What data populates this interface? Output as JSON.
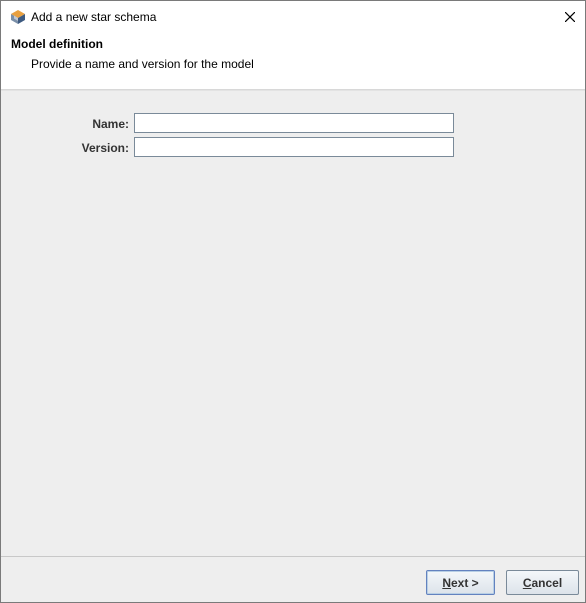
{
  "window": {
    "title": "Add a new star schema",
    "app_icon": "pentaho-cube-icon",
    "close_icon": "close-icon"
  },
  "header": {
    "title": "Model definition",
    "description": "Provide a name and version for the model"
  },
  "form": {
    "name_label": "Name:",
    "name_value": "",
    "version_label": "Version:",
    "version_value": ""
  },
  "buttons": {
    "next_mnemonic": "N",
    "next_rest": "ext >",
    "cancel_mnemonic": "C",
    "cancel_rest": "ancel"
  },
  "colors": {
    "content_bg": "#eeeeee",
    "header_bg": "#ffffff",
    "default_button_border": "#6382bf"
  }
}
